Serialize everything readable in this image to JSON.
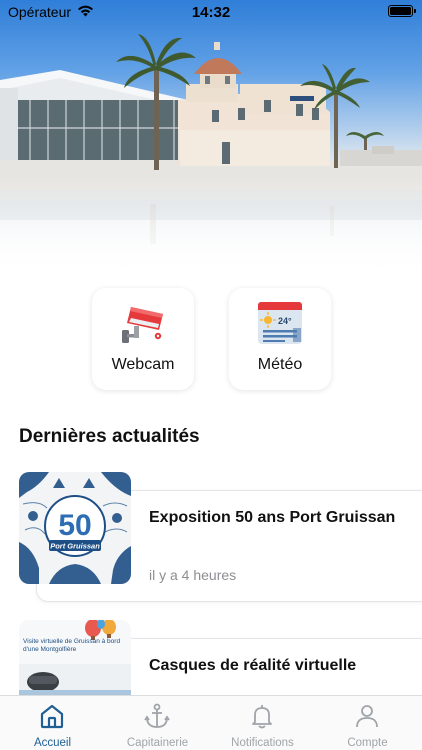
{
  "status_bar": {
    "carrier": "Opérateur",
    "time": "14:32",
    "battery_level": 1.0
  },
  "quick_actions": [
    {
      "label": "Webcam",
      "icon": "security-camera-icon"
    },
    {
      "label": "Météo",
      "icon": "weather-forecast-icon",
      "icon_text": "24°"
    }
  ],
  "news": {
    "section_title": "Dernières actualités",
    "items": [
      {
        "title": "Exposition 50 ans Port Gruissan",
        "time": "il y a 4 heures",
        "thumbnail": "anniversary-poster-image",
        "thumbnail_text": "Port Gruissan"
      },
      {
        "title": "Casques de réalité virtuelle",
        "time": "",
        "thumbnail": "virtual-reality-flyer-image",
        "thumbnail_text": "Visite virtuelle de Gruissan à bord d'une Montgolfière"
      }
    ]
  },
  "tab_bar": {
    "active": "Accueil",
    "tabs": [
      {
        "label": "Accueil",
        "icon": "home-icon"
      },
      {
        "label": "Capitainerie",
        "icon": "anchor-icon"
      },
      {
        "label": "Notifications",
        "icon": "bell-icon"
      },
      {
        "label": "Compte",
        "icon": "user-icon"
      }
    ]
  },
  "colors": {
    "accent": "#1f5f95",
    "inactive": "#a0a4a8",
    "sky": "#2f7ed8",
    "camera_red": "#e5393b"
  }
}
